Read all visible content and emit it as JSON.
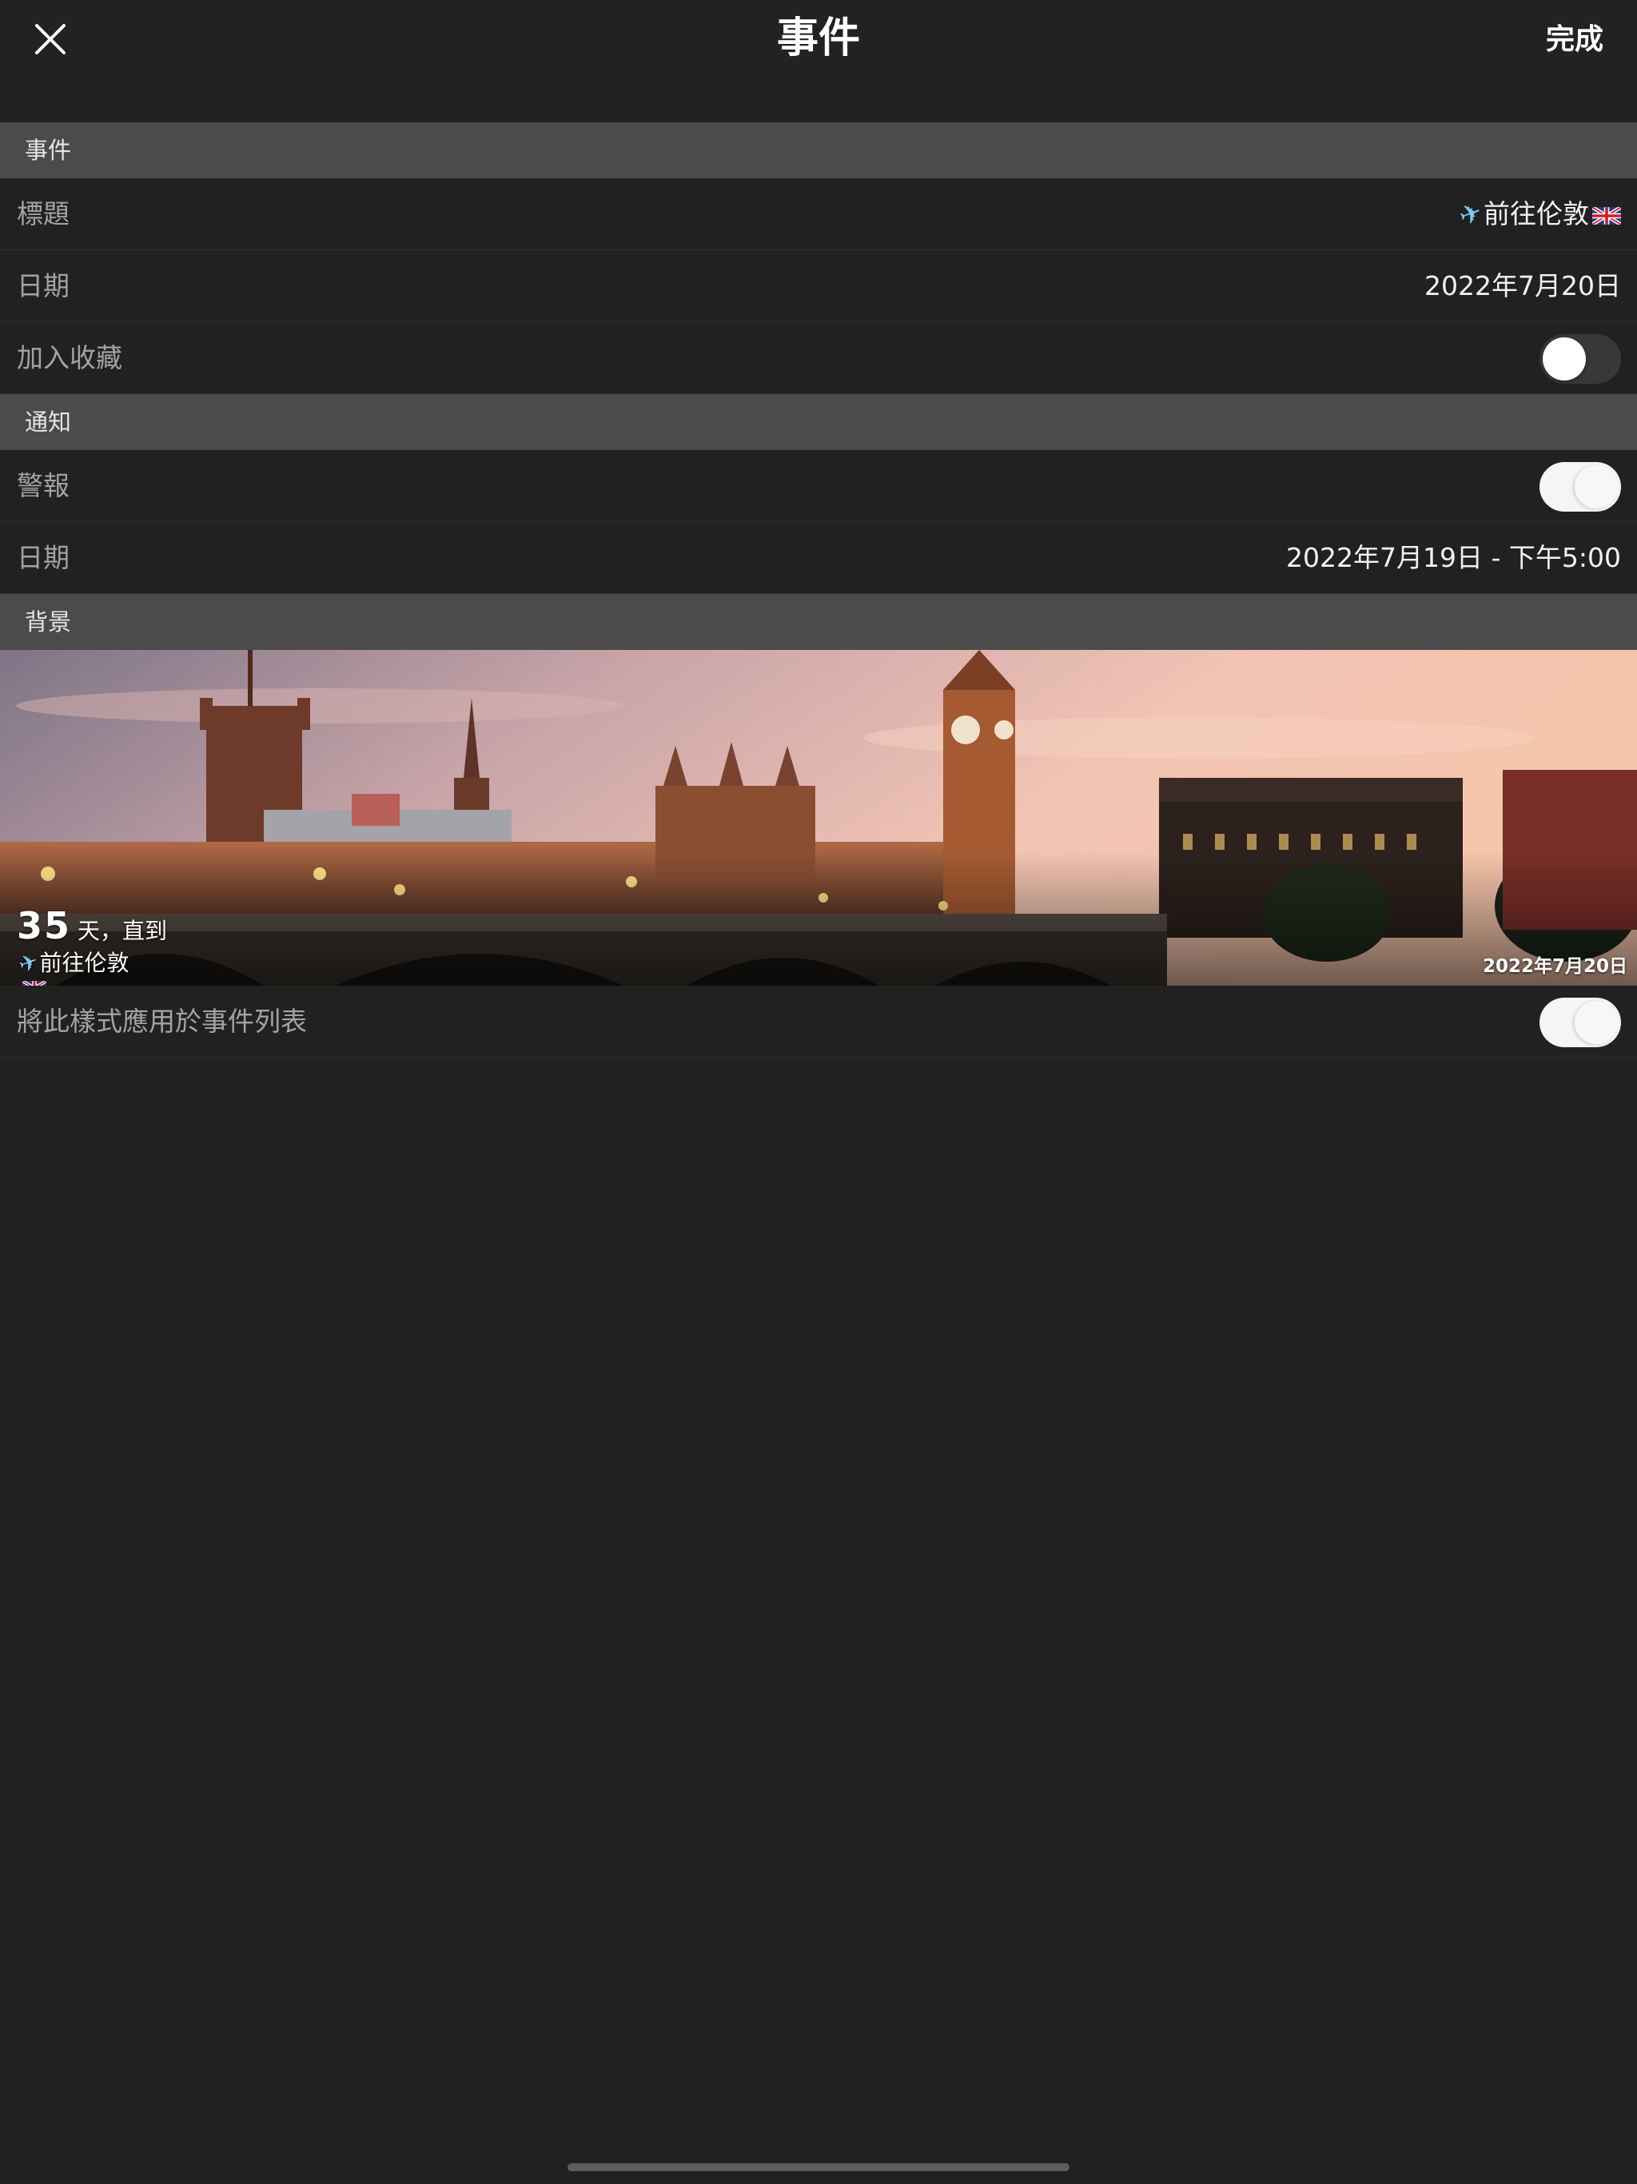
{
  "nav": {
    "title": "事件",
    "done_label": "完成",
    "close_icon": "close-icon"
  },
  "sections": {
    "event": {
      "header": "事件",
      "title_label": "標題",
      "title_value": "前往伦敦",
      "date_label": "日期",
      "date_value": "2022年7月20日",
      "favorite_label": "加入收藏",
      "favorite_on": false
    },
    "notification": {
      "header": "通知",
      "alert_label": "警報",
      "alert_on": true,
      "date_label": "日期",
      "date_value": "2022年7月19日 - 下午5:00"
    },
    "background": {
      "header": "背景",
      "days_number": "35",
      "days_suffix": "天，直到",
      "event_title": "前往伦敦",
      "event_date": "2022年7月20日",
      "apply_label": "將此樣式應用於事件列表",
      "apply_on": true
    }
  },
  "icons": {
    "plane": "✈",
    "flag": "uk-flag-icon"
  },
  "colors": {
    "background": "#212121",
    "section_header": "#4b4b4b",
    "label": "#a3a3a3",
    "value": "#f2f2f2",
    "toggle_on": "#f5f5f5",
    "toggle_off": "#383838"
  }
}
